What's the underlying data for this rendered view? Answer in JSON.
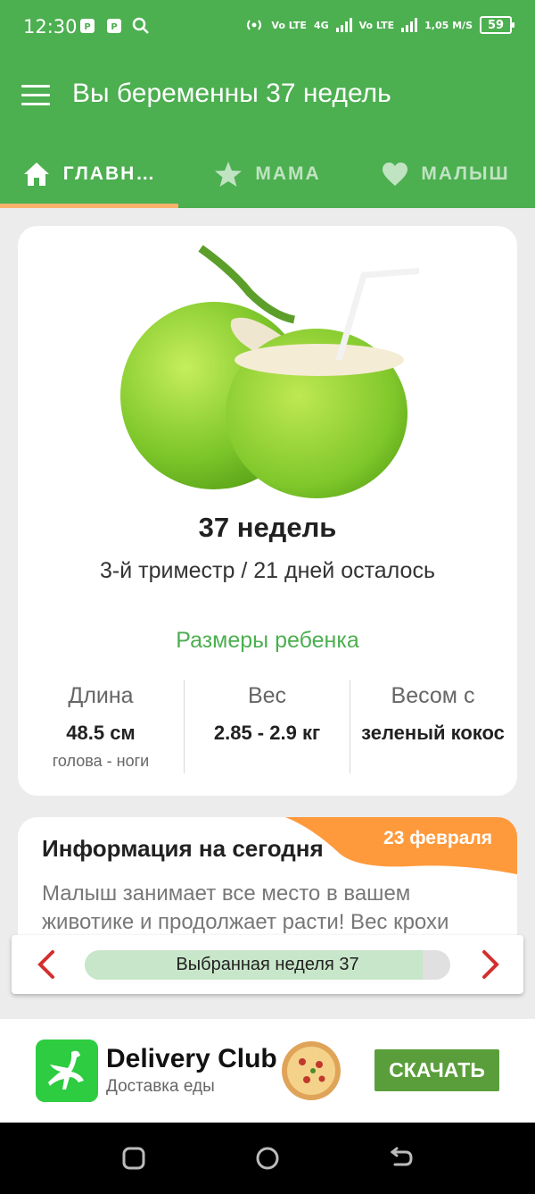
{
  "status_bar": {
    "time": "12:30",
    "indicators": [
      "Vo LTE",
      "4G",
      "Vo LTE"
    ],
    "speed": "1,05 M/S",
    "battery": "59"
  },
  "app_bar": {
    "title": "Вы беременны 37 недель",
    "menu_icon": "hamburger-menu-icon"
  },
  "tabs": [
    {
      "label": "ГЛАВН…",
      "icon": "home-icon",
      "active": true
    },
    {
      "label": "МАМА",
      "icon": "star-icon",
      "active": false
    },
    {
      "label": "МАЛЫШ",
      "icon": "heart-icon",
      "active": false
    }
  ],
  "week_card": {
    "image": "green-coconut",
    "week_title": "37 недель",
    "trimester_text": "3-й триместр / 21 дней осталось",
    "sizes_title": "Размеры ребенка",
    "stats": [
      {
        "label": "Длина",
        "value": "48.5 см",
        "sub": "голова - ноги"
      },
      {
        "label": "Вес",
        "value": "2.85 - 2.9 кг",
        "sub": ""
      },
      {
        "label": "Весом с",
        "value": "зеленый кокос",
        "sub": ""
      }
    ]
  },
  "info_card": {
    "title": "Информация на сегодня",
    "date": "23 февраля",
    "body": "Малыш занимает все место в вашем животике и продолжает расти! Вес крохи"
  },
  "week_selector": {
    "label": "Выбранная неделя 37",
    "progress_fraction": 0.925
  },
  "ad": {
    "brand": "Delivery Club",
    "subtitle": "Доставка еды",
    "button": "СКАЧАТЬ"
  },
  "colors": {
    "primary": "#4caf50",
    "tab_indicator": "#ffb26b",
    "date_banner": "#ff9a3c",
    "arrow": "#d32f2f",
    "ad_button": "#5a9e3b"
  }
}
